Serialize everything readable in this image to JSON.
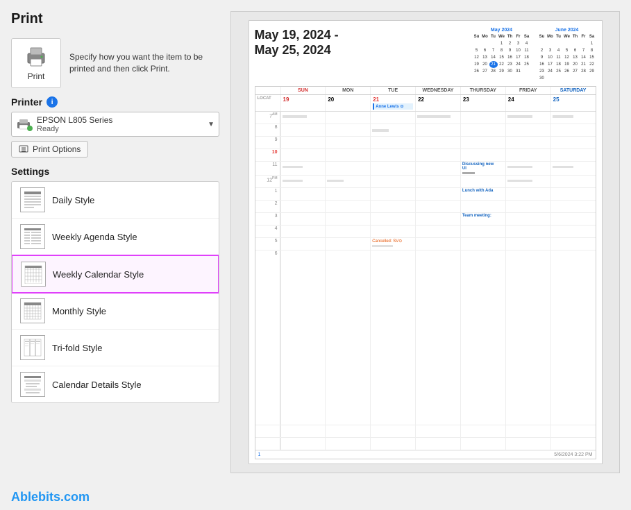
{
  "page": {
    "title": "Print"
  },
  "print_icon": {
    "label": "Print",
    "description": "Specify how you want the item to be printed and then click Print."
  },
  "printer": {
    "section_title": "Printer",
    "name": "EPSON L805 Series",
    "status": "Ready",
    "options_button": "Print Options"
  },
  "settings": {
    "section_title": "Settings",
    "styles": [
      {
        "id": "daily",
        "label": "Daily Style",
        "selected": false
      },
      {
        "id": "weekly-agenda",
        "label": "Weekly Agenda Style",
        "selected": false
      },
      {
        "id": "weekly-calendar",
        "label": "Weekly Calendar Style",
        "selected": true
      },
      {
        "id": "monthly",
        "label": "Monthly Style",
        "selected": false
      },
      {
        "id": "trifold",
        "label": "Tri-fold Style",
        "selected": false
      },
      {
        "id": "calendar-details",
        "label": "Calendar Details Style",
        "selected": false
      }
    ]
  },
  "calendar_preview": {
    "title_line1": "May 19, 2024 -",
    "title_line2": "May 25, 2024",
    "mini_month_may": {
      "title": "May 2024",
      "headers": [
        "Su",
        "Mo",
        "Tu",
        "We",
        "Th",
        "Fr",
        "Sa"
      ],
      "rows": [
        [
          "",
          "",
          "",
          "1",
          "2",
          "3",
          "4"
        ],
        [
          "5",
          "6",
          "7",
          "8",
          "9",
          "10",
          "11"
        ],
        [
          "12",
          "13",
          "14",
          "15",
          "16",
          "17",
          "18"
        ],
        [
          "19",
          "20",
          "21",
          "22",
          "23",
          "24",
          "25"
        ],
        [
          "26",
          "27",
          "28",
          "29",
          "30",
          "31",
          ""
        ]
      ],
      "today": "21"
    },
    "mini_month_june": {
      "title": "June 2024",
      "headers": [
        "Su",
        "Mo",
        "Tu",
        "We",
        "Th",
        "Fr",
        "Sa"
      ],
      "rows": [
        [
          "",
          "",
          "",
          "",
          "",
          "",
          "1"
        ],
        [
          "2",
          "3",
          "4",
          "5",
          "6",
          "7",
          "8"
        ],
        [
          "9",
          "10",
          "11",
          "12",
          "13",
          "14",
          "15"
        ],
        [
          "16",
          "17",
          "18",
          "19",
          "20",
          "21",
          "22"
        ],
        [
          "23",
          "24",
          "25",
          "26",
          "27",
          "28",
          "29"
        ],
        [
          "30",
          "",
          "",
          "",
          "",
          "",
          ""
        ]
      ]
    },
    "day_headers": [
      "SUN",
      "MON",
      "TUE",
      "WEDNESDAY",
      "THURSDAY",
      "FRIDAY",
      "SATURDAY"
    ],
    "dates": [
      "19",
      "20",
      "21",
      "22",
      "23",
      "24",
      "25"
    ],
    "event_label": "Anne Lewis",
    "time_slots": [
      {
        "time": "7 AM",
        "superscript": "AM",
        "events": []
      },
      {
        "time": "8",
        "events": []
      },
      {
        "time": "9",
        "events": []
      },
      {
        "time": "10",
        "events": [],
        "highlight": true
      },
      {
        "time": "11",
        "events": [
          {
            "col": 4,
            "text": "Discussing new UI",
            "type": "blue"
          }
        ]
      },
      {
        "time": "12 PM",
        "superscript": "PM",
        "events": []
      },
      {
        "time": "1",
        "events": [
          {
            "col": 4,
            "text": "Lunch with Ada",
            "type": "blue"
          }
        ]
      },
      {
        "time": "2",
        "events": []
      },
      {
        "time": "3",
        "events": [
          {
            "col": 4,
            "text": "Team meeting:",
            "type": "blue"
          }
        ]
      },
      {
        "time": "4",
        "events": []
      },
      {
        "time": "5",
        "events": [
          {
            "col": 2,
            "text": "Cancelled: SV",
            "type": "orange"
          }
        ]
      },
      {
        "time": "6",
        "events": []
      }
    ],
    "footer_page": "1",
    "footer_date": "5/6/2024 3:22 PM"
  },
  "footer": {
    "logo": "Ablebits.com"
  }
}
